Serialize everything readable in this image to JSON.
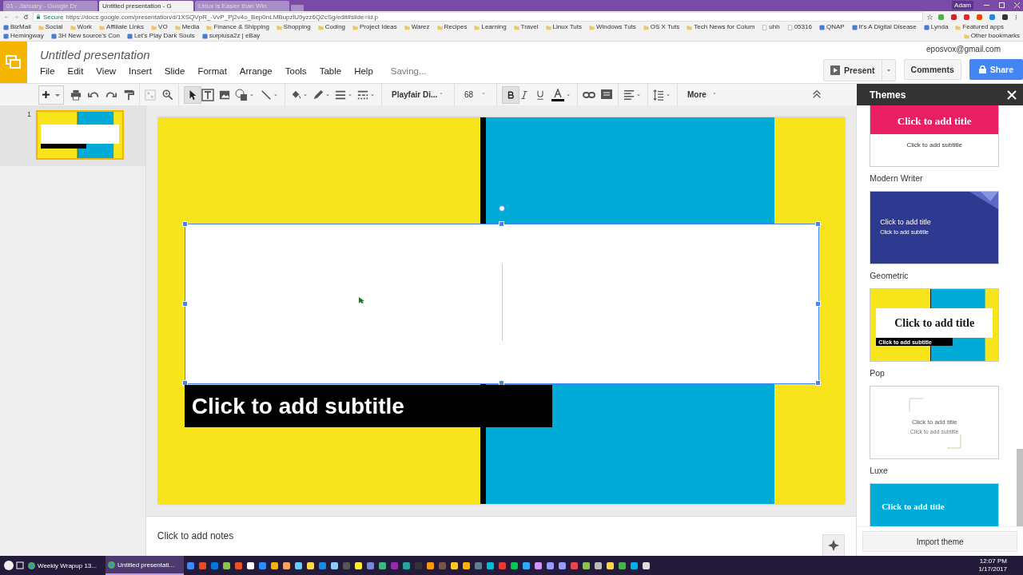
{
  "browser": {
    "tabs": [
      {
        "title": "01 - January - Google Dr",
        "selected": false
      },
      {
        "title": "Untitled presentation - G",
        "selected": true
      },
      {
        "title": "Linux is Easier than Win",
        "selected": false
      }
    ],
    "user_badge": "Adam",
    "secure_label": "Secure",
    "url": "https://docs.google.com/presentation/d/1XSQVpR_-VvP_Pj2v4o_Bep0nLMBupzlU9yzz6Q2cSg/edit#slide=id.p",
    "bookmarks": [
      {
        "label": "BizMail",
        "kind": "site"
      },
      {
        "label": "Social",
        "kind": "folder"
      },
      {
        "label": "Work",
        "kind": "folder"
      },
      {
        "label": "Affiliate Links",
        "kind": "folder"
      },
      {
        "label": "VO",
        "kind": "folder"
      },
      {
        "label": "Media",
        "kind": "folder"
      },
      {
        "label": "Finance & Shipping",
        "kind": "folder"
      },
      {
        "label": "Shopping",
        "kind": "folder"
      },
      {
        "label": "Coding",
        "kind": "folder"
      },
      {
        "label": "Project Ideas",
        "kind": "folder"
      },
      {
        "label": "Warez",
        "kind": "folder"
      },
      {
        "label": "Recipes",
        "kind": "folder"
      },
      {
        "label": "Learning",
        "kind": "folder"
      },
      {
        "label": "Travel",
        "kind": "folder"
      },
      {
        "label": "Linux Tuts",
        "kind": "folder"
      },
      {
        "label": "Windows Tuts",
        "kind": "folder"
      },
      {
        "label": "OS X Tuts",
        "kind": "folder"
      },
      {
        "label": "Tech News for Colum",
        "kind": "folder"
      },
      {
        "label": "uhh",
        "kind": "page"
      },
      {
        "label": "05316",
        "kind": "page"
      },
      {
        "label": "QNAP",
        "kind": "site"
      },
      {
        "label": "It's A Digital Disease",
        "kind": "site"
      },
      {
        "label": "Lynda",
        "kind": "site"
      },
      {
        "label": "Featured apps",
        "kind": "folder"
      },
      {
        "label": "Hemingway",
        "kind": "site"
      },
      {
        "label": "3H New source's Con",
        "kind": "site"
      },
      {
        "label": "Let's Play Dark Souls",
        "kind": "site"
      },
      {
        "label": "surplusa2z | eBay",
        "kind": "site"
      }
    ],
    "other_bookmarks": "Other bookmarks"
  },
  "app": {
    "doc_title": "Untitled presentation",
    "menu": [
      "File",
      "Edit",
      "View",
      "Insert",
      "Slide",
      "Format",
      "Arrange",
      "Tools",
      "Table",
      "Help"
    ],
    "status": "Saving...",
    "account": "eposvox@gmail.com",
    "present": "Present",
    "comments": "Comments",
    "share": "Share"
  },
  "toolbar": {
    "font": "Playfair Di...",
    "size": "68",
    "bold": true,
    "more": "More"
  },
  "slides": [
    {
      "number": "1",
      "selected": true
    }
  ],
  "slide": {
    "subtitle": "Click to add subtitle"
  },
  "notes_placeholder": "Click to add notes",
  "themes": {
    "title": "Themes",
    "items": [
      {
        "kind": "pink",
        "title": "Click to add title",
        "subtitle": "Click to add subtitle",
        "name": "Modern Writer"
      },
      {
        "kind": "geometric",
        "title": "Click to add title",
        "subtitle": "Click to add subtitle",
        "name": "Geometric"
      },
      {
        "kind": "pop",
        "title": "Click to add title",
        "subtitle": "Click to add subtitle",
        "name": "Pop"
      },
      {
        "kind": "luxe",
        "title": "Click to add title",
        "subtitle": "Click to add subtitle",
        "name": "Luxe"
      },
      {
        "kind": "blue",
        "title": "Click to add title"
      }
    ],
    "import_button": "Import theme"
  },
  "taskbar": {
    "windows": [
      {
        "title": "Weekly Wrapup 13...",
        "selected": false
      },
      {
        "title": "Untitled presentati...",
        "selected": true
      }
    ],
    "time": "12:07 PM",
    "date": "1/17/2017"
  }
}
